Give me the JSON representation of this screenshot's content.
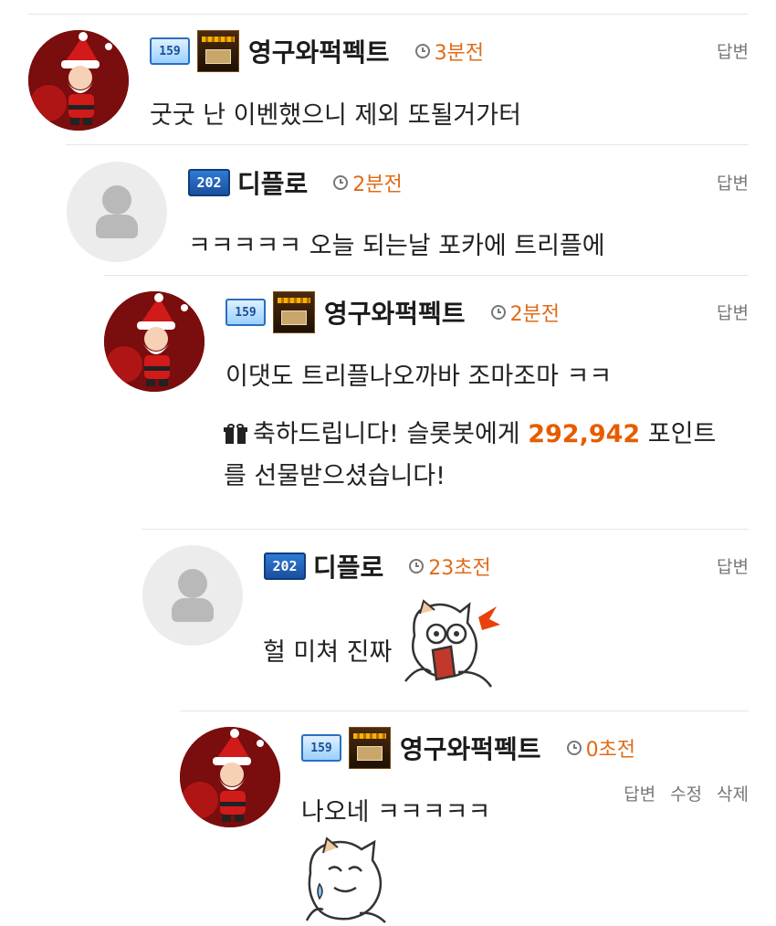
{
  "comments": [
    {
      "nickname": "영구와퍽펙트",
      "level_label": "159",
      "time": "3분전",
      "text": "굿굿 난 이벤했으니 제외 또될거가터",
      "actions": [
        "답변"
      ]
    },
    {
      "nickname": "디플로",
      "level_label": "202",
      "time": "2분전",
      "text": "ㅋㅋㅋㅋㅋ 오늘 되는날 포카에 트리플에",
      "actions": [
        "답변"
      ]
    },
    {
      "nickname": "영구와퍽펙트",
      "level_label": "159",
      "time": "2분전",
      "text": "이댓도  트리플나오까바 조마조마 ㅋㅋ",
      "gift": {
        "prefix": "축하드립니다! 슬롯봇에게 ",
        "points": "292,942",
        "suffix": " 포인트",
        "line2": "를 선물받으셨습니다!"
      },
      "actions": [
        "답변"
      ]
    },
    {
      "nickname": "디플로",
      "level_label": "202",
      "time": "23초전",
      "text": "헐 미쳐 진짜",
      "actions": [
        "답변"
      ]
    },
    {
      "nickname": "영구와퍽펙트",
      "level_label": "159",
      "time": "0초전",
      "text": "나오네 ㅋㅋㅋㅋㅋ",
      "actions": [
        "답변",
        "수정",
        "삭제"
      ]
    }
  ],
  "icons": {
    "clock": "clock-icon",
    "gift": "gift-icon",
    "default_avatar": "user-silhouette-icon",
    "santa_avatar": "santa-avatar",
    "emoticon_shocked": "shocked-cat-emoticon",
    "emoticon_sweating": "sweating-cat-emoticon"
  },
  "colors": {
    "time": "#e06b1a",
    "points": "#e65c00",
    "divider": "#e6e6e6",
    "action": "#777777"
  }
}
